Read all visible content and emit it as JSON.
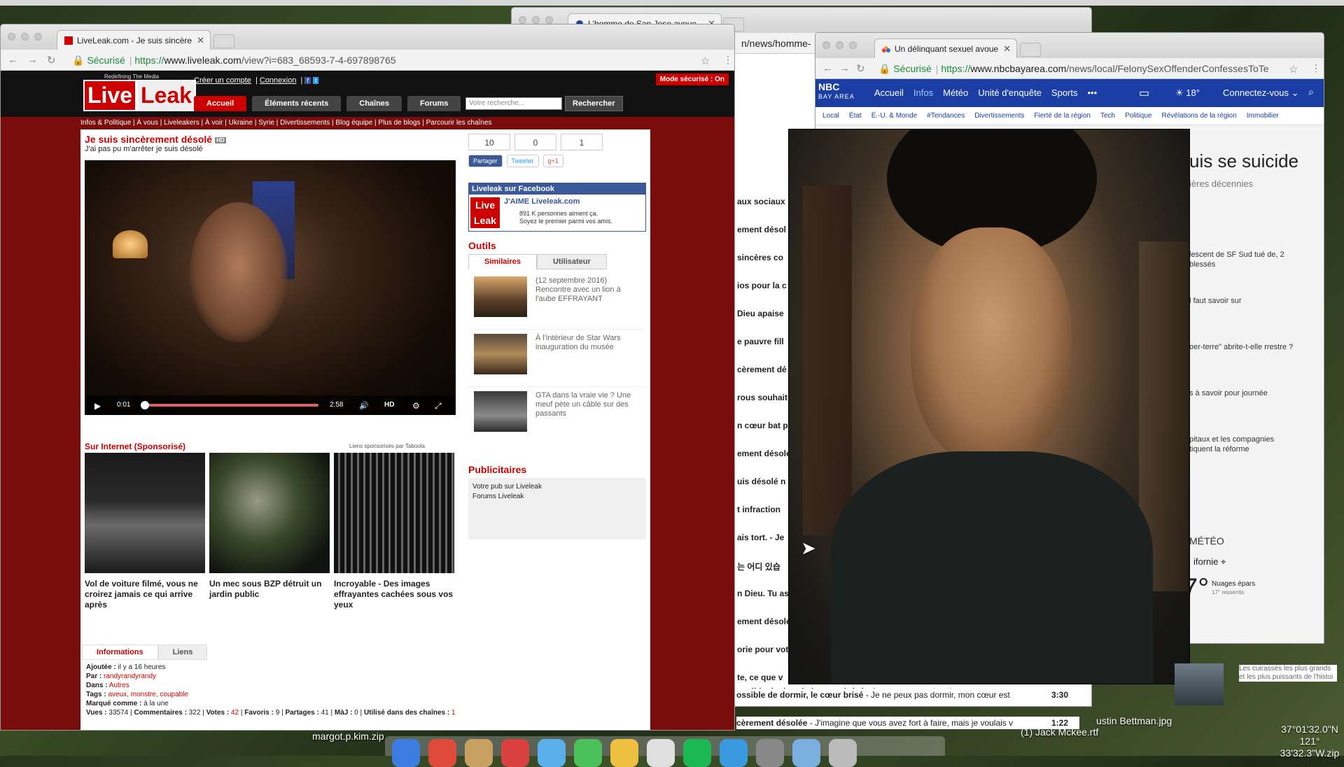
{
  "back_window": {
    "tab_title": "L'homme de San Jose avoue",
    "url_fragment": "n/news/homme-",
    "lines": [
      "aux sociaux",
      "ement désol",
      "sincères co",
      "ios pour la c",
      "Dieu apaise",
      "e pauvre fill",
      "cèrement dé",
      "rous souhait",
      "n cœur bat p",
      "ement désolé",
      "uis désolé n",
      "t infraction",
      "ais tort. - Je",
      "는 어디 있습",
      "n Dieu. Tu as",
      "ement désolé",
      "orie pour vot",
      "te, ce que v"
    ],
    "bottom_items": [
      {
        "title": "ossible de dormir, le cœur brisé",
        "text": " - Je ne peux pas dormir, mon cœur est",
        "duration": "3:30"
      },
      {
        "title": "cèrement désolée",
        "text": " - J'imagine que vous avez fort à faire, mais je voulais v",
        "duration": "1:22"
      }
    ]
  },
  "liveleak": {
    "tab_title": "LiveLeak.com - Je suis sincère",
    "url_secure": "Sécurisé",
    "url_proto": "https://",
    "url_host": "www.liveleak.com",
    "url_path": "/view?i=683_68593-7-4-697898765",
    "logo_tag": "Redefining The Media",
    "logo_live": "Live",
    "logo_leak": "Leak",
    "top_links": [
      "Créer un compte",
      "Connexion"
    ],
    "safe_mode": "Mode sécurisé : On",
    "nav": [
      "Accueil",
      "Éléments récents",
      "Chaînes",
      "Forums"
    ],
    "search_placeholder": "Votre recherche...",
    "search_button": "Rechercher",
    "subnav": "Infos & Politique  |  À vous  |  Liveleakers  |  À voir  |  Ukraine  |  Syrie  |  Divertissements  |  Blog équipe  |  Plus de blogs  |  Parcourir les chaînes",
    "video_title": "Je suis sincèrement désolé",
    "hd_badge": "HD",
    "video_subtitle": "J'ai pas pu m'arrêter je suis désolé",
    "time_current": "0:01",
    "time_total": "2:58",
    "hd_label": "HD",
    "counts": [
      "10",
      "0",
      "1"
    ],
    "share_fb": "Partager",
    "share_tw": "Tweeter",
    "share_gp": "g+1",
    "fb_box_title": "Liveleak sur Facebook",
    "fb_mini_live": "Live",
    "fb_mini_leak": "Leak",
    "fb_like": "J'AIME Liveleak.com",
    "fb_fans_1": "891 K personnes aiment ça.",
    "fb_fans_2": "Soyez le premier parmi vos amis.",
    "outils": "Outils",
    "tabs": [
      "Similaires",
      "Utilisateur"
    ],
    "similar": [
      {
        "text": "(12 septembre 2016) Rencontre avec un lion à l'aube EFFRAYANT"
      },
      {
        "text": "À l'intérieur de Star Wars  inauguration du musée"
      },
      {
        "text": "GTA dans la vraie vie ? Une meuf  pète un câble sur des passants"
      }
    ],
    "sponsored_title": "Sur Internet (Sponsorisé)",
    "taboola": "Liens sponsorisés par Taboola",
    "sponsored": [
      {
        "caption": "Vol de voiture filmé, vous ne croirez jamais ce qui arrive après"
      },
      {
        "caption": "Un mec sous BZP détruit un jardin public"
      },
      {
        "caption": "Incroyable - Des images effrayantes cachées sous vos yeux"
      }
    ],
    "pubs_title": "Publicitaires",
    "pubs": [
      "Votre pub sur Liveleak",
      "Forums Liveleak"
    ],
    "info_tabs": [
      "Informations",
      "Liens"
    ],
    "info": {
      "added_label": "Ajoutée :",
      "added": " il y a 16 heures",
      "by_label": "Par :",
      "by": "randyrandyrandy",
      "in_label": "Dans :",
      "in": "Autres",
      "tags_label": "Tags :",
      "tags": "aveux, monstre, coupable",
      "marked_label": "Marqué comme :",
      "marked": " à la une",
      "views_label": "Vues :",
      "views": "33574",
      "comments_label": "Commentaires :",
      "comments": "322",
      "votes_label": "Votes :",
      "votes": "42",
      "favs_label": "Favoris :",
      "favs": "9",
      "shares_label": "Partages :",
      "shares": "41",
      "maj_label": "MàJ :",
      "maj": "0",
      "used_label": "Utilisé dans des chaînes :",
      "used": "1"
    }
  },
  "nbc": {
    "tab_title": "Un délinquant sexuel avoue",
    "url_secure": "Sécurisé",
    "url_proto": "https://",
    "url_host": "www.nbcbayarea.com",
    "url_path": "/news/local/FelonySexOffenderConfessesToTe",
    "logo": "NBC",
    "logo_sub": "BAY AREA",
    "nav": [
      "Accueil",
      "Infos",
      "Météo",
      "Unité d'enquête",
      "Sports",
      "•••"
    ],
    "weather": "18°",
    "connect": "Connectez-vous",
    "subnav": [
      "Local",
      "État",
      "É.-U. & Monde",
      "#Tendances",
      "Divertissements",
      "Fierté de la région",
      "Tech",
      "Politique",
      "Révélations de la région",
      "Immobilier"
    ],
    "headline": "uis se suicide",
    "subheadline": "ières décennies",
    "side_items": [
      "lescent de SF Sud tué de, 2 blessés",
      "l faut savoir sur",
      "oer-terre\" abrite-t-elle rrestre ?",
      "s à savoir pour journée",
      "pitaux et les compagnies tiquent la réforme"
    ],
    "meteo": "MÉTÉO",
    "region": "ifornie",
    "temp": "7°",
    "cond": "Nuages épars",
    "feels": "17° ressentis",
    "bottom_caption": "Les cuirassés les plus grands et les plus puissants de l'histoi"
  },
  "desktop": {
    "file1": "margot.p.kim.zip",
    "file2": "ustin Bettman.jpg",
    "file3": "(1) Jack Mckee.rtf",
    "coords_1": "37°01'32.0\"N 121°",
    "coords_2": "33'32.3\"W.zip"
  },
  "colors": {
    "liveleak_red": "#cc0000",
    "nbc_blue": "#1b3ea4"
  }
}
